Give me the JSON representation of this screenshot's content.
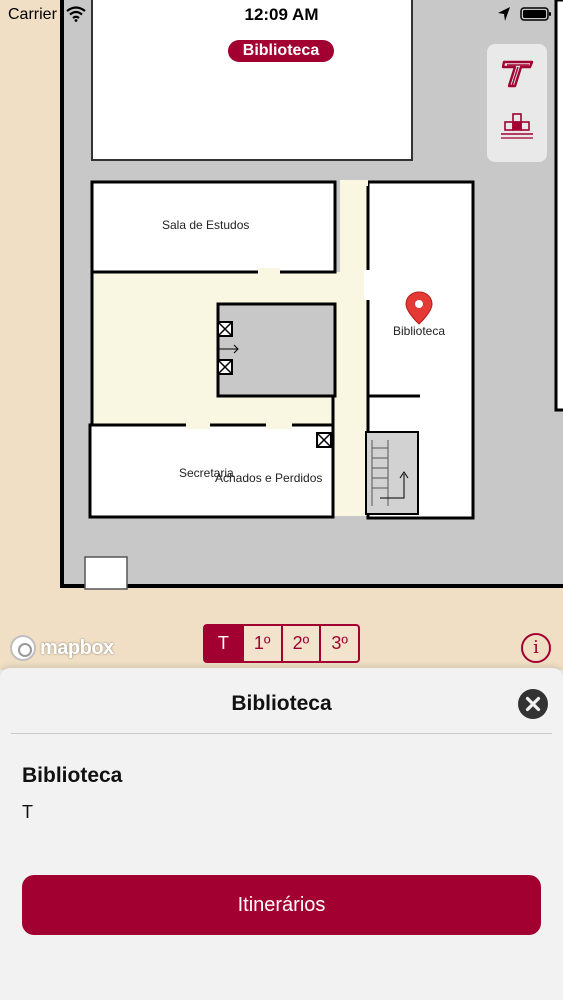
{
  "status_bar": {
    "carrier": "Carrier",
    "time": "12:09 AM"
  },
  "map": {
    "building_label": "Biblioteca",
    "rooms": {
      "study_room": "Sala de Estudos",
      "library": "Biblioteca",
      "secretary": "Secretaria",
      "lost_and_found": "Achados e Perdidos"
    },
    "attribution": "mapbox",
    "colors": {
      "ground": "#f0dfc4",
      "building": "#c8c8c8",
      "corridor": "#f9f6e1",
      "room": "#ffffff",
      "pin": "#e53935"
    }
  },
  "toolbar": {
    "logo_icon": "university-logo-icon",
    "floors_icon": "floor-levels-icon"
  },
  "floors": {
    "items": [
      "T",
      "1º",
      "2º",
      "3º"
    ],
    "selected": "T"
  },
  "info_button": {
    "label": "i"
  },
  "sheet": {
    "title": "Biblioteca",
    "place_name": "Biblioteca",
    "floor": "T",
    "action_label": "Itinerários"
  },
  "theme": {
    "accent": "#a30032",
    "sheet_bg": "#f2f2f2"
  }
}
